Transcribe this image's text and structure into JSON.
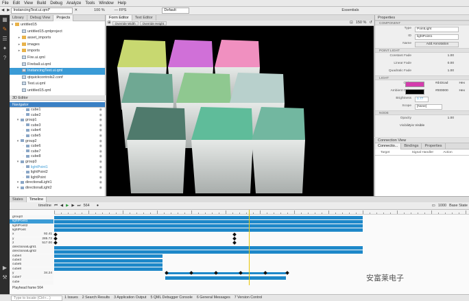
{
  "menu": [
    "File",
    "Edit",
    "View",
    "Build",
    "Debug",
    "Analyze",
    "Tools",
    "Window",
    "Help"
  ],
  "toolbar": {
    "file_combo": "InstancingTest.ui.qml*",
    "zoom": "100 %",
    "fps": "— FPS",
    "style_combo": "Default",
    "workspace_combo": "Essentials"
  },
  "library": {
    "tabs": [
      "Library",
      "Debug View",
      "Projects"
    ],
    "selected_tab": "Projects",
    "root": "untitled15",
    "files": [
      {
        "name": "untitled15.qmlproject",
        "type": "file",
        "indent": 1
      },
      {
        "name": "asset_imports",
        "type": "folder",
        "indent": 1
      },
      {
        "name": "images",
        "type": "folder",
        "indent": 1
      },
      {
        "name": "imports",
        "type": "folder",
        "indent": 1
      },
      {
        "name": "Fire.ui.qml",
        "type": "file",
        "indent": 1
      },
      {
        "name": "Fireball.ui.qml",
        "type": "file",
        "indent": 1
      },
      {
        "name": "InstancingTest.ui.qml",
        "type": "file",
        "indent": 1,
        "selected": true
      },
      {
        "name": "qtquickcontrols2.conf",
        "type": "file",
        "indent": 1
      },
      {
        "name": "Test.ui.qml",
        "type": "file",
        "indent": 1
      },
      {
        "name": "untitled15.qml",
        "type": "file",
        "indent": 1
      }
    ]
  },
  "editor3d_label": "3D Editor",
  "navigator": {
    "title": "Navigator",
    "items": [
      {
        "name": "cube1",
        "level": 2
      },
      {
        "name": "cube2",
        "level": 2
      },
      {
        "name": "group1",
        "level": 1
      },
      {
        "name": "cube3",
        "level": 2
      },
      {
        "name": "cube4",
        "level": 2
      },
      {
        "name": "cube5",
        "level": 2
      },
      {
        "name": "group2",
        "level": 1
      },
      {
        "name": "cube6",
        "level": 2
      },
      {
        "name": "cube7",
        "level": 2
      },
      {
        "name": "cube8",
        "level": 2
      },
      {
        "name": "group3",
        "level": 1
      },
      {
        "name": "lightPoint1",
        "level": 2,
        "selected": true
      },
      {
        "name": "lightPoint2",
        "level": 2
      },
      {
        "name": "lightPoint",
        "level": 2
      },
      {
        "name": "directionalLight1",
        "level": 1
      },
      {
        "name": "directionalLight2",
        "level": 1
      }
    ]
  },
  "editor": {
    "tabs": [
      "Form Editor",
      "Text Editor"
    ],
    "overrides": [
      "Override Width",
      "Override Height"
    ],
    "zoom": "150 %",
    "tiles": [
      {
        "row": 0,
        "col": 0,
        "color": "#c8d870"
      },
      {
        "row": 0,
        "col": 1,
        "color": "#d070d8"
      },
      {
        "row": 0,
        "col": 2,
        "color": "#f090c0"
      },
      {
        "row": 1,
        "col": 0,
        "color": "#6fa893"
      },
      {
        "row": 1,
        "col": 1,
        "color": "#8fc890"
      },
      {
        "row": 1,
        "col": 2,
        "color": "#b8d0cc"
      },
      {
        "row": 2,
        "col": 0,
        "color": "#4f7a6c"
      },
      {
        "row": 2,
        "col": 1,
        "color": "#5fbc9a"
      },
      {
        "row": 2,
        "col": 2,
        "color": "#72b7a0"
      }
    ]
  },
  "properties": {
    "title": "Properties",
    "sections": {
      "component": "COMPONENT",
      "point_light": "POINT LIGHT",
      "light": "LIGHT",
      "node": "NODE"
    },
    "type_label": "Type",
    "type_value": "PointLight",
    "id_label": "ID",
    "id_value": "lightPoint1",
    "name_label": "Name",
    "name_button": "Add Annotation",
    "constant_fade_label": "Constant Fade",
    "constant_fade": "1.00",
    "linear_fade_label": "Linear Fade",
    "linear_fade": "0.00",
    "quadratic_fade_label": "Quadratic Fade",
    "quadratic_fade": "1.00",
    "color_label": "Color",
    "color_value": "#d43cad",
    "color_swatch": "#d43cad",
    "ambient_label": "Ambient Color",
    "ambient_value": "#000000",
    "ambient_swatch": "#000000",
    "hex_label": "Hex",
    "brightness_label": "Brightness",
    "brightness": "0.77",
    "scope_label": "Scope",
    "scope": "[None]",
    "opacity_label": "Opacity",
    "opacity": "1.00",
    "visibility_label": "Visibility",
    "visibility": "is Visible"
  },
  "connection_view": {
    "title": "Connection View",
    "tabs": [
      "Connectio...",
      "Bindings",
      "Properties"
    ],
    "columns": [
      "Target",
      "Signal Handler",
      "Action"
    ]
  },
  "timeline": {
    "tabs": [
      "States",
      "Timeline"
    ],
    "selected_tab": "Timeline",
    "timeline_name": "timeline",
    "current_frame": "564",
    "end_frame": "1000",
    "base_state": "Base State",
    "playhead": "Playhead frame 564",
    "playhead_fraction": 0.63,
    "rows": [
      {
        "label": "group3",
        "bar": [
          0.0,
          1.0
        ]
      },
      {
        "label": "lightPoint1",
        "selected": true,
        "bar": [
          0.0,
          1.0
        ]
      },
      {
        "label": "lightPoint2",
        "bar": [
          0.0,
          1.0
        ]
      },
      {
        "label": "lightPoint",
        "bar": [
          0.0,
          1.0
        ]
      },
      {
        "label": "x",
        "value": "92.41",
        "keyframes": [
          0.0,
          0.58
        ]
      },
      {
        "label": "y",
        "value": "285.72",
        "keyframes": [
          0.0,
          0.58
        ]
      },
      {
        "label": "z",
        "value": "517.00",
        "keyframes": [
          0.0,
          0.58
        ]
      },
      {
        "label": "directionalLight1",
        "bar": [
          0.0,
          1.0
        ]
      },
      {
        "label": "directionalLight2",
        "bar": [
          0.0,
          1.0
        ]
      },
      {
        "label": "cube4",
        "bar": [
          0.0,
          0.35
        ]
      },
      {
        "label": "cube3",
        "bar": [
          0.0,
          0.35
        ]
      },
      {
        "label": "cube5",
        "bar": [
          0.0,
          0.35
        ]
      },
      {
        "label": "cube8",
        "bar": [
          0.0,
          0.35
        ]
      },
      {
        "label": "y",
        "value": "34.24",
        "keyframes": [
          0.36,
          0.44,
          0.52,
          0.6,
          0.68,
          0.75
        ],
        "thin": true
      },
      {
        "label": "cube7",
        "bar": [
          0.36,
          0.75
        ]
      },
      {
        "label": "cube",
        "bar": [
          0.0,
          1.0
        ],
        "empty": true
      }
    ]
  },
  "status": {
    "search_placeholder": "Type to locate (Ctrl+...)",
    "items": [
      "1 Issues",
      "2 Search Results",
      "3 Application Output",
      "5 QML Debugger Console",
      "6 General Messages",
      "7 Version Control"
    ]
  },
  "watermark": "安富莱电子"
}
